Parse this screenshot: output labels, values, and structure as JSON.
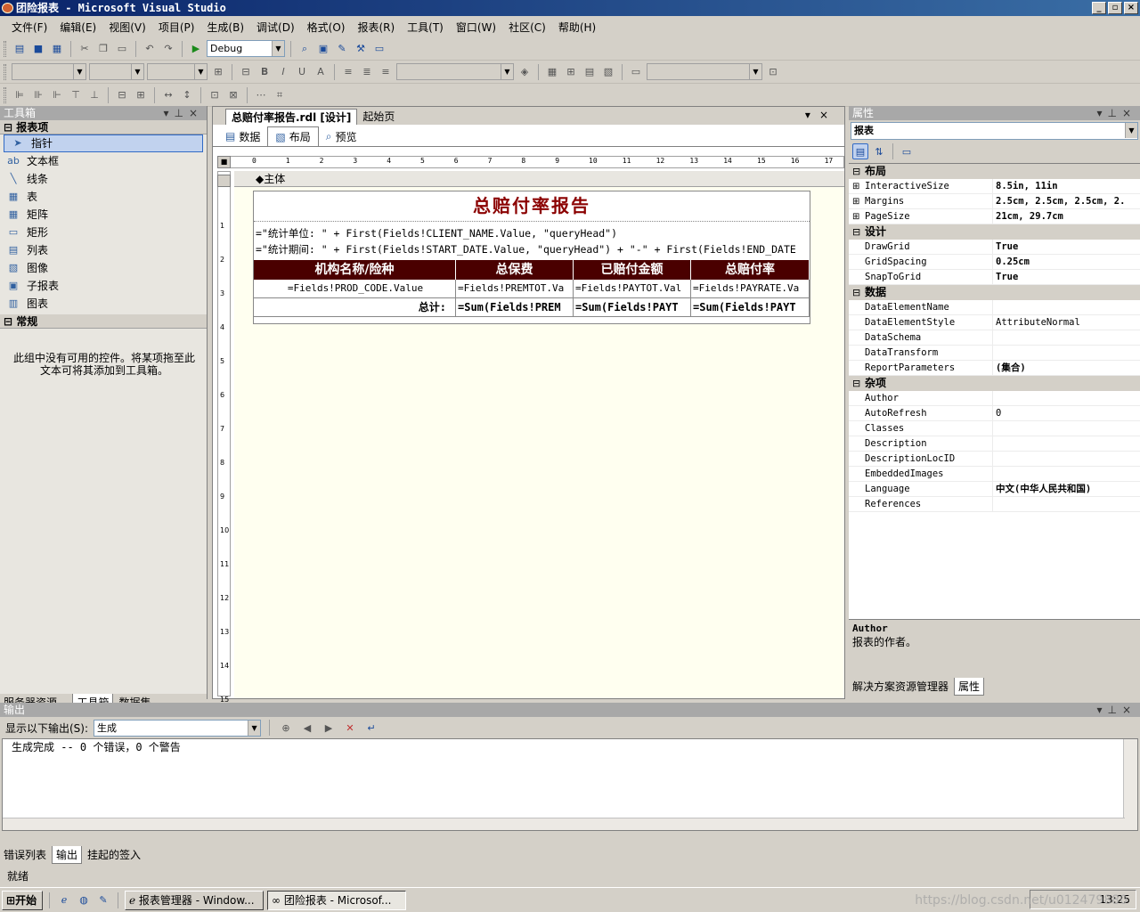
{
  "window": {
    "title": "团险报表 - Microsoft Visual Studio"
  },
  "menu": [
    "文件(F)",
    "编辑(E)",
    "视图(V)",
    "项目(P)",
    "生成(B)",
    "调试(D)",
    "格式(O)",
    "报表(R)",
    "工具(T)",
    "窗口(W)",
    "社区(C)",
    "帮助(H)"
  ],
  "toolbar": {
    "config": "Debug"
  },
  "toolbox": {
    "title": "工具箱",
    "category_report": "报表项",
    "items": [
      "指针",
      "文本框",
      "线条",
      "表",
      "矩阵",
      "矩形",
      "列表",
      "图像",
      "子报表",
      "图表"
    ],
    "category_general": "常规",
    "empty_msg": "此组中没有可用的控件。将某项拖至此文本可将其添加到工具箱。",
    "tabs": [
      "服务器资源...",
      "工具箱",
      "数据集"
    ]
  },
  "doc": {
    "tabs": [
      "总赔付率报告.rdl [设计]",
      "起始页"
    ],
    "subtabs": [
      "数据",
      "布局",
      "预览"
    ],
    "body_label": "主体",
    "ruler": [
      "0",
      "1",
      "2",
      "3",
      "4",
      "5",
      "6",
      "7",
      "8",
      "9",
      "10",
      "11",
      "12",
      "13",
      "14",
      "15",
      "16",
      "17"
    ],
    "vruler": [
      "1",
      "2",
      "3",
      "4",
      "5",
      "6",
      "7",
      "8",
      "9",
      "10",
      "11",
      "12",
      "13",
      "14",
      "15"
    ]
  },
  "report": {
    "title": "总赔付率报告",
    "line1": "=\"统计单位: \" + First(Fields!CLIENT_NAME.Value, \"queryHead\")",
    "line2": "=\"统计期间: \" + First(Fields!START_DATE.Value, \"queryHead\") + \"-\" + First(Fields!END_DATE",
    "headers": [
      "机构名称/险种",
      "总保费",
      "已赔付金额",
      "总赔付率"
    ],
    "detail": [
      "=Fields!PROD_CODE.Value",
      "=Fields!PREMTOT.Va",
      "=Fields!PAYTOT.Val",
      "=Fields!PAYRATE.Va"
    ],
    "total": [
      "总计:",
      "=Sum(Fields!PREM",
      "=Sum(Fields!PAYT",
      "=Sum(Fields!PAYT"
    ]
  },
  "properties": {
    "title": "属性",
    "object": "报表",
    "groups": [
      {
        "name": "布局",
        "rows": [
          {
            "name": "InteractiveSize",
            "value": "8.5in, 11in",
            "bold": true,
            "exp": true
          },
          {
            "name": "Margins",
            "value": "2.5cm, 2.5cm, 2.5cm, 2.",
            "bold": true,
            "exp": true
          },
          {
            "name": "PageSize",
            "value": "21cm, 29.7cm",
            "bold": true,
            "exp": true
          }
        ]
      },
      {
        "name": "设计",
        "rows": [
          {
            "name": "DrawGrid",
            "value": "True",
            "bold": true
          },
          {
            "name": "GridSpacing",
            "value": "0.25cm",
            "bold": true
          },
          {
            "name": "SnapToGrid",
            "value": "True",
            "bold": true
          }
        ]
      },
      {
        "name": "数据",
        "rows": [
          {
            "name": "DataElementName",
            "value": ""
          },
          {
            "name": "DataElementStyle",
            "value": "AttributeNormal"
          },
          {
            "name": "DataSchema",
            "value": ""
          },
          {
            "name": "DataTransform",
            "value": ""
          },
          {
            "name": "ReportParameters",
            "value": "(集合)",
            "bold": true
          }
        ]
      },
      {
        "name": "杂项",
        "rows": [
          {
            "name": "Author",
            "value": ""
          },
          {
            "name": "AutoRefresh",
            "value": "0"
          },
          {
            "name": "Classes",
            "value": ""
          },
          {
            "name": "Description",
            "value": ""
          },
          {
            "name": "DescriptionLocID",
            "value": ""
          },
          {
            "name": "EmbeddedImages",
            "value": ""
          },
          {
            "name": "Language",
            "value": "中文(中华人民共和国)",
            "bold": true
          },
          {
            "name": "References",
            "value": ""
          }
        ]
      }
    ],
    "desc_title": "Author",
    "desc_text": "报表的作者。",
    "tabs": [
      "解决方案资源管理器",
      "属性"
    ]
  },
  "output": {
    "title": "输出",
    "show_label": "显示以下输出(S):",
    "show_value": "生成",
    "text": "生成完成 -- 0 个错误，0 个警告",
    "tabs": [
      "错误列表",
      "输出",
      "挂起的签入"
    ]
  },
  "status": "就绪",
  "taskbar": {
    "start": "开始",
    "tasks": [
      "报表管理器 - Window...",
      "团险报表 - Microsof..."
    ],
    "clock": "13:25",
    "watermark": "https://blog.csdn.net/u012479880"
  }
}
